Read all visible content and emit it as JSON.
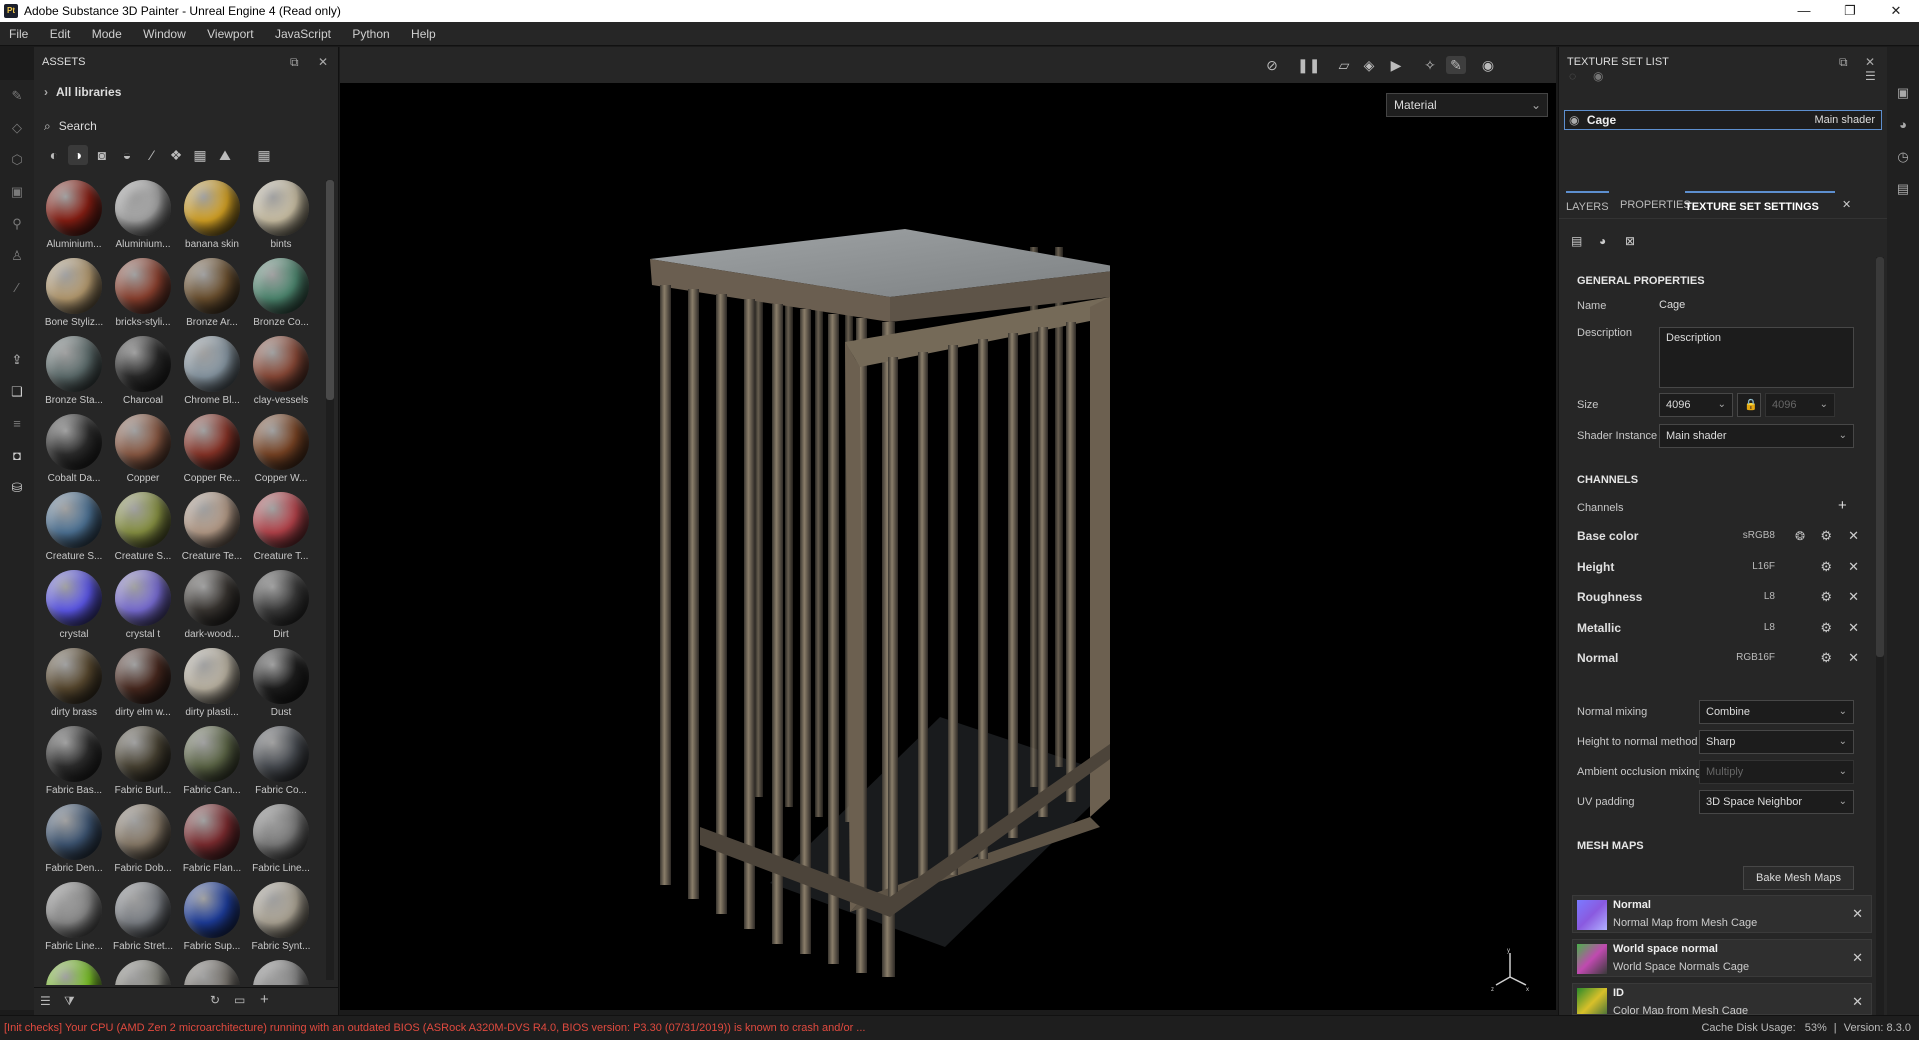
{
  "window": {
    "app_icon_text": "Pt",
    "title": "Adobe Substance 3D Painter - Unreal Engine 4 (Read only)",
    "minimize": "—",
    "maximize": "❐",
    "close": "✕"
  },
  "menu": [
    "File",
    "Edit",
    "Mode",
    "Window",
    "Viewport",
    "JavaScript",
    "Python",
    "Help"
  ],
  "assets": {
    "title": "ASSETS",
    "library": "All libraries",
    "search_placeholder": "Search",
    "materials": [
      {
        "name": "Aluminium...",
        "color": "#8a1f14"
      },
      {
        "name": "Aluminium...",
        "color": "#a8a8a8"
      },
      {
        "name": "banana skin",
        "color": "#d8a525"
      },
      {
        "name": "bints",
        "color": "#cfc4a8"
      },
      {
        "name": "Bone Styliz...",
        "color": "#b99e72"
      },
      {
        "name": "bricks-styli...",
        "color": "#8e4230"
      },
      {
        "name": "Bronze Ar...",
        "color": "#6e5230"
      },
      {
        "name": "Bronze Co...",
        "color": "#4f8a72"
      },
      {
        "name": "Bronze Sta...",
        "color": "#5f6f6f"
      },
      {
        "name": "Charcoal",
        "color": "#2a2a2a"
      },
      {
        "name": "Chrome Bl...",
        "color": "#8a9aa6"
      },
      {
        "name": "clay-vessels",
        "color": "#8c4a38"
      },
      {
        "name": "Cobalt Da...",
        "color": "#2d2d2d"
      },
      {
        "name": "Copper",
        "color": "#8c5a44"
      },
      {
        "name": "Copper Re...",
        "color": "#8a3428"
      },
      {
        "name": "Copper W...",
        "color": "#7a4424"
      },
      {
        "name": "Creature S...",
        "color": "#4f7598"
      },
      {
        "name": "Creature S...",
        "color": "#8a9444"
      },
      {
        "name": "Creature Te...",
        "color": "#b89e8a"
      },
      {
        "name": "Creature T...",
        "color": "#b8444c"
      },
      {
        "name": "crystal",
        "color": "#5f5aee"
      },
      {
        "name": "crystal t",
        "color": "#7b6fd8"
      },
      {
        "name": "dark-wood...",
        "color": "#3a3632"
      },
      {
        "name": "Dirt",
        "color": "#3c3c3c"
      },
      {
        "name": "dirty brass",
        "color": "#5a4a30"
      },
      {
        "name": "dirty elm w...",
        "color": "#4a2a20"
      },
      {
        "name": "dirty plasti...",
        "color": "#bfb7a6"
      },
      {
        "name": "Dust",
        "color": "#1e1e1e"
      },
      {
        "name": "Fabric Bas...",
        "color": "#2e2e2e"
      },
      {
        "name": "Fabric Burl...",
        "color": "#4a4434"
      },
      {
        "name": "Fabric Can...",
        "color": "#5e6848"
      },
      {
        "name": "Fabric Co...",
        "color": "#4a4e54"
      },
      {
        "name": "Fabric Den...",
        "color": "#3e5674"
      },
      {
        "name": "Fabric Dob...",
        "color": "#8a7c6a"
      },
      {
        "name": "Fabric Flan...",
        "color": "#7e2c30"
      },
      {
        "name": "Fabric Line...",
        "color": "#7e7e7e"
      },
      {
        "name": "Fabric Line...",
        "color": "#8c8c8c"
      },
      {
        "name": "Fabric Stret...",
        "color": "#7e8288"
      },
      {
        "name": "Fabric Sup...",
        "color": "#1e3e9e"
      },
      {
        "name": "Fabric Synt...",
        "color": "#b0a898"
      },
      {
        "name": "",
        "color": "#7ec828"
      },
      {
        "name": "",
        "color": "#8a8a82"
      },
      {
        "name": "",
        "color": "#7a7670"
      },
      {
        "name": "",
        "color": "#8a8a8a"
      }
    ]
  },
  "viewport": {
    "mode_dropdown": "Material"
  },
  "texture_set_list": {
    "title": "TEXTURE SET LIST",
    "item_name": "Cage",
    "item_shader": "Main shader"
  },
  "tabs": {
    "layers": "LAYERS",
    "properties": "PROPERTIES",
    "texture_set_settings": "TEXTURE SET SETTINGS"
  },
  "general": {
    "title": "GENERAL PROPERTIES",
    "name_label": "Name",
    "name_value": "Cage",
    "description_label": "Description",
    "description_value": "Description",
    "size_label": "Size",
    "size_value": "4096",
    "size_value_locked": "4096",
    "shader_label": "Shader Instance",
    "shader_value": "Main shader"
  },
  "channels": {
    "title": "CHANNELS",
    "add_label": "Channels",
    "items": [
      {
        "name": "Base color",
        "format": "sRGB8"
      },
      {
        "name": "Height",
        "format": "L16F"
      },
      {
        "name": "Roughness",
        "format": "L8"
      },
      {
        "name": "Metallic",
        "format": "L8"
      },
      {
        "name": "Normal",
        "format": "RGB16F"
      }
    ],
    "normal_mixing_label": "Normal mixing",
    "normal_mixing_value": "Combine",
    "height_method_label": "Height to normal method",
    "height_method_value": "Sharp",
    "ao_mixing_label": "Ambient occlusion mixing",
    "ao_mixing_value": "Multiply",
    "uv_padding_label": "UV padding",
    "uv_padding_value": "3D Space Neighbor"
  },
  "mesh_maps": {
    "title": "MESH MAPS",
    "bake_button": "Bake Mesh Maps",
    "items": [
      {
        "title": "Normal",
        "subtitle": "Normal Map from Mesh Cage"
      },
      {
        "title": "World space normal",
        "subtitle": "World Space Normals Cage"
      },
      {
        "title": "ID",
        "subtitle": "Color Map from Mesh Cage"
      }
    ]
  },
  "status": {
    "message": "[Init checks] Your CPU (AMD Zen 2 microarchitecture) running with an outdated BIOS (ASRock A320M-DVS R4.0, BIOS version: P3.30 (07/31/2019)) is known to crash and/or ...",
    "cache_label": "Cache Disk Usage:",
    "cache_value": "53%",
    "version": "Version: 8.3.0"
  }
}
